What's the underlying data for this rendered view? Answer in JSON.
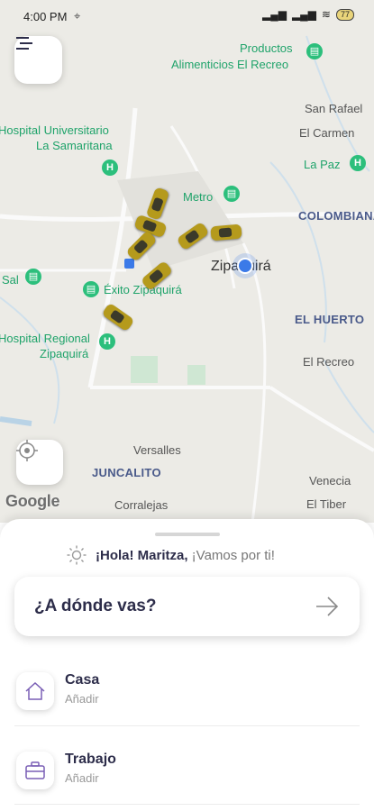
{
  "status_bar": {
    "time": "4:00 PM",
    "battery": "77"
  },
  "map": {
    "labels": {
      "productos": "Productos",
      "alimenticios": "Alimenticios El Recreo",
      "san_rafael": "San Rafael",
      "el_carmen": "El Carmen",
      "la_paz": "La Paz",
      "hospital_univ_1": "Hospital Universitario",
      "hospital_univ_2": "La Samaritana",
      "metro": "Metro",
      "colombiana": "COLOMBIANA",
      "zipaquira": "Zipaquirá",
      "sal": "Sal",
      "exito": "Éxito Zipaquirá",
      "el_huerto": "EL HUERTO",
      "hospital_reg_1": "Hospital Regional",
      "hospital_reg_2": "Zipaquirá",
      "el_recreo": "El Recreo",
      "versalles": "Versalles",
      "juncalito": "JUNCALITO",
      "venecia": "Venecia",
      "corralejas": "Corralejas",
      "el_tiber": "El Tiber",
      "google": "Google"
    }
  },
  "sheet": {
    "greeting_name": "¡Hola! Maritza,",
    "greeting_rest": " ¡Vamos por ti!",
    "search_label": "¿A dónde vas?",
    "places": [
      {
        "title": "Casa",
        "subtitle": "Añadir"
      },
      {
        "title": "Trabajo",
        "subtitle": "Añadir"
      }
    ]
  },
  "colors": {
    "accent": "#2d2d4a",
    "poi_green": "#2cbf7c",
    "taxi": "#b59a1c"
  }
}
